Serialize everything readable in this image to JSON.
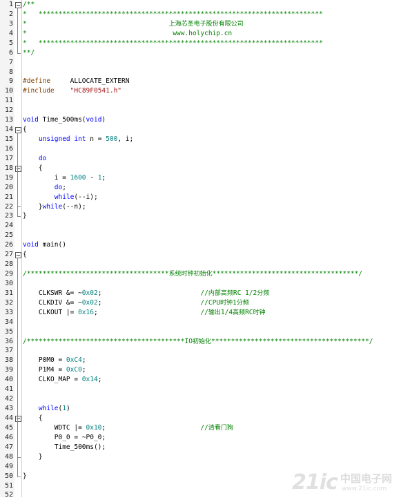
{
  "editor": {
    "lines": [
      {
        "n": "1",
        "fold": "open",
        "parts": [
          {
            "t": "/**",
            "c": "c-com"
          }
        ]
      },
      {
        "n": "2",
        "parts": [
          {
            "t": "*   ************************************************************************",
            "c": "c-com"
          }
        ]
      },
      {
        "n": "3",
        "parts": [
          {
            "t": "*                                    ",
            "c": "c-com"
          },
          {
            "t": "上海芯圣电子股份有限公司",
            "c": "c-com cn"
          }
        ]
      },
      {
        "n": "4",
        "parts": [
          {
            "t": "*                                     www.holychip.cn",
            "c": "c-com"
          }
        ]
      },
      {
        "n": "5",
        "parts": [
          {
            "t": "*   ************************************************************************",
            "c": "c-com"
          }
        ]
      },
      {
        "n": "6",
        "fold": "end",
        "parts": [
          {
            "t": "**/",
            "c": "c-com"
          }
        ]
      },
      {
        "n": "7",
        "parts": []
      },
      {
        "n": "8",
        "parts": []
      },
      {
        "n": "9",
        "parts": [
          {
            "t": "#define",
            "c": "c-pp"
          },
          {
            "t": "     ALLOCATE_EXTERN",
            "c": "c-plain"
          }
        ]
      },
      {
        "n": "10",
        "parts": [
          {
            "t": "#include",
            "c": "c-pp"
          },
          {
            "t": "    ",
            "c": "c-plain"
          },
          {
            "t": "\"HC89F0541.h\"",
            "c": "c-str"
          }
        ]
      },
      {
        "n": "11",
        "parts": []
      },
      {
        "n": "12",
        "parts": []
      },
      {
        "n": "13",
        "parts": [
          {
            "t": "void",
            "c": "c-kw"
          },
          {
            "t": " Time_500ms(",
            "c": "c-plain"
          },
          {
            "t": "void",
            "c": "c-kw"
          },
          {
            "t": ")",
            "c": "c-plain"
          }
        ]
      },
      {
        "n": "14",
        "fold": "open",
        "parts": [
          {
            "t": "{",
            "c": "c-plain"
          }
        ]
      },
      {
        "n": "15",
        "parts": [
          {
            "t": "    ",
            "c": "c-plain"
          },
          {
            "t": "unsigned int",
            "c": "c-kw"
          },
          {
            "t": " n = ",
            "c": "c-plain"
          },
          {
            "t": "500",
            "c": "c-num"
          },
          {
            "t": ", i;",
            "c": "c-plain"
          }
        ]
      },
      {
        "n": "16",
        "parts": []
      },
      {
        "n": "17",
        "parts": [
          {
            "t": "    ",
            "c": "c-plain"
          },
          {
            "t": "do",
            "c": "c-kw"
          }
        ]
      },
      {
        "n": "18",
        "fold": "open",
        "parts": [
          {
            "t": "    {",
            "c": "c-plain"
          }
        ]
      },
      {
        "n": "19",
        "parts": [
          {
            "t": "        i = ",
            "c": "c-plain"
          },
          {
            "t": "1600",
            "c": "c-num"
          },
          {
            "t": " - ",
            "c": "c-plain"
          },
          {
            "t": "1",
            "c": "c-num"
          },
          {
            "t": ";",
            "c": "c-plain"
          }
        ]
      },
      {
        "n": "20",
        "parts": [
          {
            "t": "        ",
            "c": "c-plain"
          },
          {
            "t": "do",
            "c": "c-kw"
          },
          {
            "t": ";",
            "c": "c-plain"
          }
        ]
      },
      {
        "n": "21",
        "parts": [
          {
            "t": "        ",
            "c": "c-plain"
          },
          {
            "t": "while",
            "c": "c-kw"
          },
          {
            "t": "(--i);",
            "c": "c-plain"
          }
        ]
      },
      {
        "n": "22",
        "fold": "end",
        "parts": [
          {
            "t": "    }",
            "c": "c-plain"
          },
          {
            "t": "while",
            "c": "c-kw"
          },
          {
            "t": "(--n);",
            "c": "c-plain"
          }
        ]
      },
      {
        "n": "23",
        "fold": "end",
        "parts": [
          {
            "t": "}",
            "c": "c-plain"
          }
        ]
      },
      {
        "n": "24",
        "parts": []
      },
      {
        "n": "25",
        "parts": []
      },
      {
        "n": "26",
        "parts": [
          {
            "t": "void",
            "c": "c-kw"
          },
          {
            "t": " main()",
            "c": "c-plain"
          }
        ]
      },
      {
        "n": "27",
        "fold": "open",
        "parts": [
          {
            "t": "{",
            "c": "c-plain"
          }
        ]
      },
      {
        "n": "28",
        "parts": []
      },
      {
        "n": "29",
        "parts": [
          {
            "t": "/************************************",
            "c": "c-com"
          },
          {
            "t": "系统时钟初始化",
            "c": "c-com cn"
          },
          {
            "t": "*************************************/",
            "c": "c-com"
          }
        ]
      },
      {
        "n": "30",
        "parts": []
      },
      {
        "n": "31",
        "parts": [
          {
            "t": "    CLKSWR &= ~",
            "c": "c-plain"
          },
          {
            "t": "0x02",
            "c": "c-num"
          },
          {
            "t": ";                         ",
            "c": "c-plain"
          },
          {
            "t": "//",
            "c": "c-com"
          },
          {
            "t": "内部高频",
            "c": "c-com cn"
          },
          {
            "t": "RC 1/2",
            "c": "c-com"
          },
          {
            "t": "分频",
            "c": "c-com cn"
          }
        ]
      },
      {
        "n": "32",
        "parts": [
          {
            "t": "    CLKDIV &= ~",
            "c": "c-plain"
          },
          {
            "t": "0x02",
            "c": "c-num"
          },
          {
            "t": ";                         ",
            "c": "c-plain"
          },
          {
            "t": "//CPU",
            "c": "c-com"
          },
          {
            "t": "时钟",
            "c": "c-com cn"
          },
          {
            "t": "1",
            "c": "c-com"
          },
          {
            "t": "分频",
            "c": "c-com cn"
          }
        ]
      },
      {
        "n": "33",
        "parts": [
          {
            "t": "    CLKOUT |= ",
            "c": "c-plain"
          },
          {
            "t": "0x16",
            "c": "c-num"
          },
          {
            "t": ";                          ",
            "c": "c-plain"
          },
          {
            "t": "//",
            "c": "c-com"
          },
          {
            "t": "输出",
            "c": "c-com cn"
          },
          {
            "t": "1/4",
            "c": "c-com"
          },
          {
            "t": "高频",
            "c": "c-com cn"
          },
          {
            "t": "RC",
            "c": "c-com"
          },
          {
            "t": "时钟",
            "c": "c-com cn"
          }
        ]
      },
      {
        "n": "34",
        "parts": []
      },
      {
        "n": "35",
        "parts": []
      },
      {
        "n": "36",
        "parts": [
          {
            "t": "/****************************************",
            "c": "c-com"
          },
          {
            "t": "IO",
            "c": "c-com"
          },
          {
            "t": "初始化",
            "c": "c-com cn"
          },
          {
            "t": "****************************************/",
            "c": "c-com"
          }
        ]
      },
      {
        "n": "37",
        "parts": []
      },
      {
        "n": "38",
        "parts": [
          {
            "t": "    P0M0 = ",
            "c": "c-plain"
          },
          {
            "t": "0xC4",
            "c": "c-num"
          },
          {
            "t": ";",
            "c": "c-plain"
          }
        ]
      },
      {
        "n": "39",
        "parts": [
          {
            "t": "    P1M4 = ",
            "c": "c-plain"
          },
          {
            "t": "0xC0",
            "c": "c-num"
          },
          {
            "t": ";",
            "c": "c-plain"
          }
        ]
      },
      {
        "n": "40",
        "parts": [
          {
            "t": "    CLKO_MAP = ",
            "c": "c-plain"
          },
          {
            "t": "0x14",
            "c": "c-num"
          },
          {
            "t": ";",
            "c": "c-plain"
          }
        ]
      },
      {
        "n": "41",
        "parts": []
      },
      {
        "n": "42",
        "parts": []
      },
      {
        "n": "43",
        "parts": [
          {
            "t": "    ",
            "c": "c-plain"
          },
          {
            "t": "while",
            "c": "c-kw"
          },
          {
            "t": "(",
            "c": "c-plain"
          },
          {
            "t": "1",
            "c": "c-num"
          },
          {
            "t": ")",
            "c": "c-plain"
          }
        ]
      },
      {
        "n": "44",
        "fold": "open",
        "parts": [
          {
            "t": "    {",
            "c": "c-plain"
          }
        ]
      },
      {
        "n": "45",
        "parts": [
          {
            "t": "        WDTC |= ",
            "c": "c-plain"
          },
          {
            "t": "0x10",
            "c": "c-num"
          },
          {
            "t": ";                        ",
            "c": "c-plain"
          },
          {
            "t": "//",
            "c": "c-com"
          },
          {
            "t": "清看门狗",
            "c": "c-com cn"
          }
        ]
      },
      {
        "n": "46",
        "parts": [
          {
            "t": "        P0_0 = ~P0_0;",
            "c": "c-plain"
          }
        ]
      },
      {
        "n": "47",
        "parts": [
          {
            "t": "        Time_500ms();",
            "c": "c-plain"
          }
        ]
      },
      {
        "n": "48",
        "fold": "end",
        "parts": [
          {
            "t": "    }",
            "c": "c-plain"
          }
        ]
      },
      {
        "n": "49",
        "parts": []
      },
      {
        "n": "50",
        "fold": "end",
        "parts": [
          {
            "t": "}",
            "c": "c-plain"
          }
        ]
      },
      {
        "n": "51",
        "parts": []
      },
      {
        "n": "52",
        "parts": []
      }
    ]
  },
  "watermark": {
    "logo_text": "21ic",
    "site_name": "中国电子网",
    "url": "www.21ic.com"
  }
}
